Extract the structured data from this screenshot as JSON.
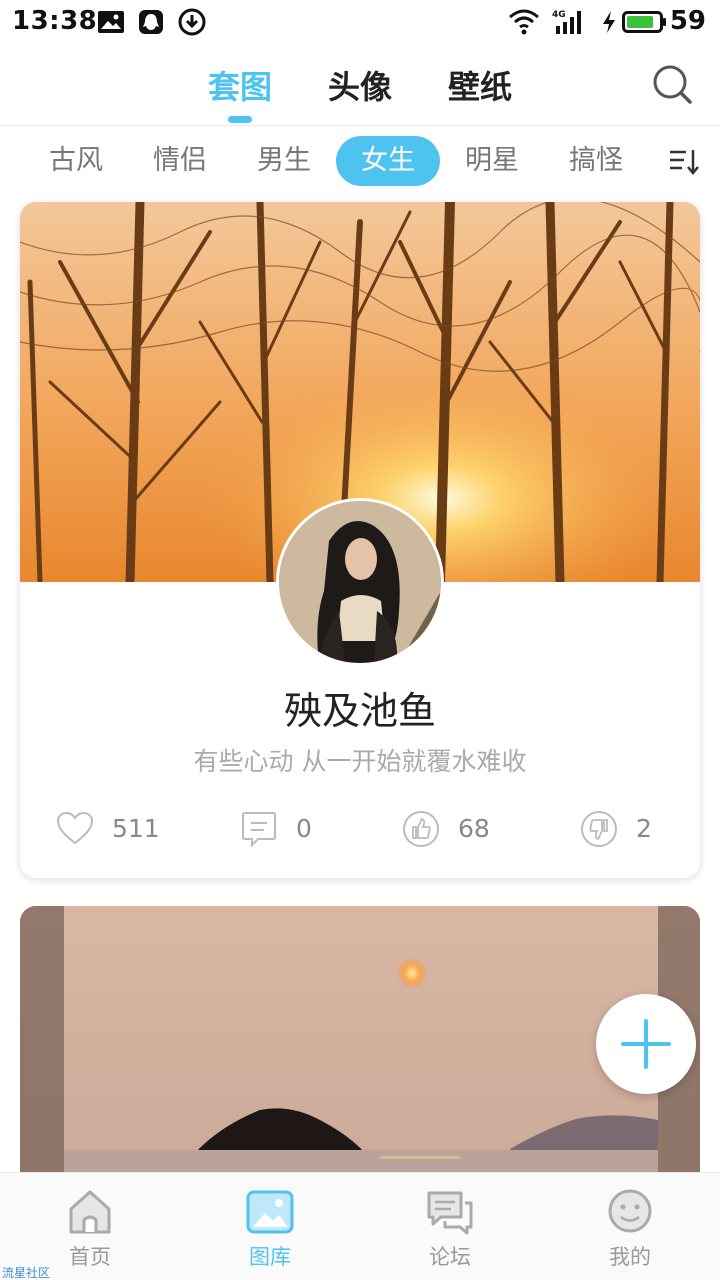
{
  "status_bar": {
    "time": "13:38",
    "battery_level": "59",
    "icons": [
      "image-icon",
      "qq-icon",
      "download-icon",
      "wifi-icon",
      "signal-4g-icon",
      "charging-icon",
      "battery-icon"
    ]
  },
  "top_tabs": {
    "items": [
      {
        "label": "套图",
        "active": true
      },
      {
        "label": "头像",
        "active": false
      },
      {
        "label": "壁纸",
        "active": false
      }
    ],
    "search_icon": "search-icon"
  },
  "categories": {
    "items": [
      {
        "label": "古风",
        "active": false
      },
      {
        "label": "情侣",
        "active": false
      },
      {
        "label": "男生",
        "active": false
      },
      {
        "label": "女生",
        "active": true
      },
      {
        "label": "明星",
        "active": false
      },
      {
        "label": "搞怪",
        "active": false
      }
    ],
    "sort_icon": "sort-icon"
  },
  "feed": {
    "card1": {
      "title": "殃及池鱼",
      "subtitle": "有些心动  从一开始就覆水难收",
      "likes": "511",
      "comments": "0",
      "thumbs_up": "68",
      "thumbs_down": "2"
    }
  },
  "fab": {
    "icon": "plus-icon"
  },
  "bottom_nav": {
    "items": [
      {
        "label": "首页",
        "icon": "home-icon",
        "active": false
      },
      {
        "label": "图库",
        "icon": "gallery-icon",
        "active": true
      },
      {
        "label": "论坛",
        "icon": "forum-icon",
        "active": false
      },
      {
        "label": "我的",
        "icon": "profile-icon",
        "active": false
      }
    ]
  },
  "watermark": "流星社区",
  "colors": {
    "accent": "#4fc3f0",
    "text_dark": "#222222",
    "text_muted": "#aaaaaa"
  }
}
